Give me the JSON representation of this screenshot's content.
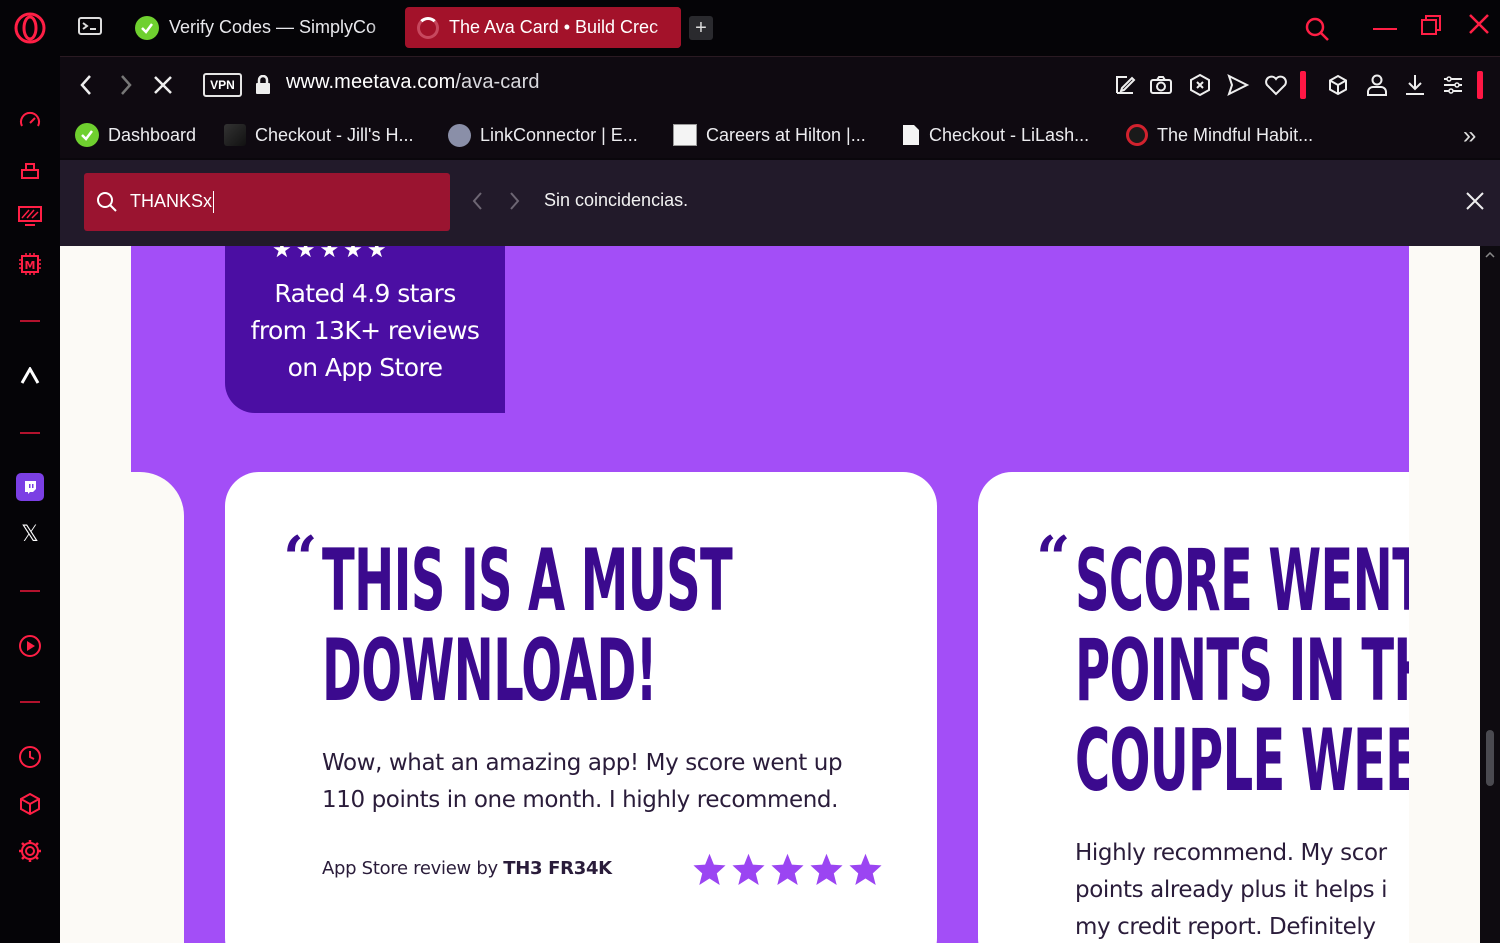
{
  "tabs": [
    {
      "label": "Verify Codes — SimplyCo",
      "active": false
    },
    {
      "label": "The Ava Card • Build Crec",
      "active": true
    }
  ],
  "address": {
    "vpn_label": "VPN",
    "url_host": "www.meetava.com",
    "url_path": "/ava-card"
  },
  "bookmarks": [
    {
      "label": "Dashboard",
      "icon": "simplycodes-icon"
    },
    {
      "label": "Checkout - Jill's H...",
      "icon": "store-icon"
    },
    {
      "label": "LinkConnector | E...",
      "icon": "linkconnector-icon"
    },
    {
      "label": "Careers at Hilton |...",
      "icon": "hilton-icon"
    },
    {
      "label": "Checkout - LiLash...",
      "icon": "document-icon"
    },
    {
      "label": "The Mindful Habit...",
      "icon": "mindful-icon"
    }
  ],
  "find": {
    "query": "THANKSx",
    "status": "Sin coincidencias."
  },
  "page": {
    "rating_lines": [
      "Rated 4.9 stars",
      "from 13K+ reviews",
      "on App Store"
    ],
    "review1": {
      "headline_lines": [
        "THIS IS A MUST",
        "DOWNLOAD!"
      ],
      "body_lines": [
        "Wow, what an amazing app! My score went up",
        "110 points in one month. I highly recommend."
      ],
      "byline_prefix": "App Store review by ",
      "author": "TH3 FR34K"
    },
    "review2": {
      "headline_lines": [
        "SCORE WENT",
        "POINTS IN TH",
        "COUPLE WEEI"
      ],
      "body_lines": [
        "Highly recommend. My scor",
        "points already plus it helps i",
        "my credit report. Definitely"
      ]
    }
  },
  "colors": {
    "accent_red": "#a3122a",
    "page_purple": "#a34ef7",
    "headline_purple": "#3b0a8e",
    "star_purple": "#9b45f2"
  }
}
